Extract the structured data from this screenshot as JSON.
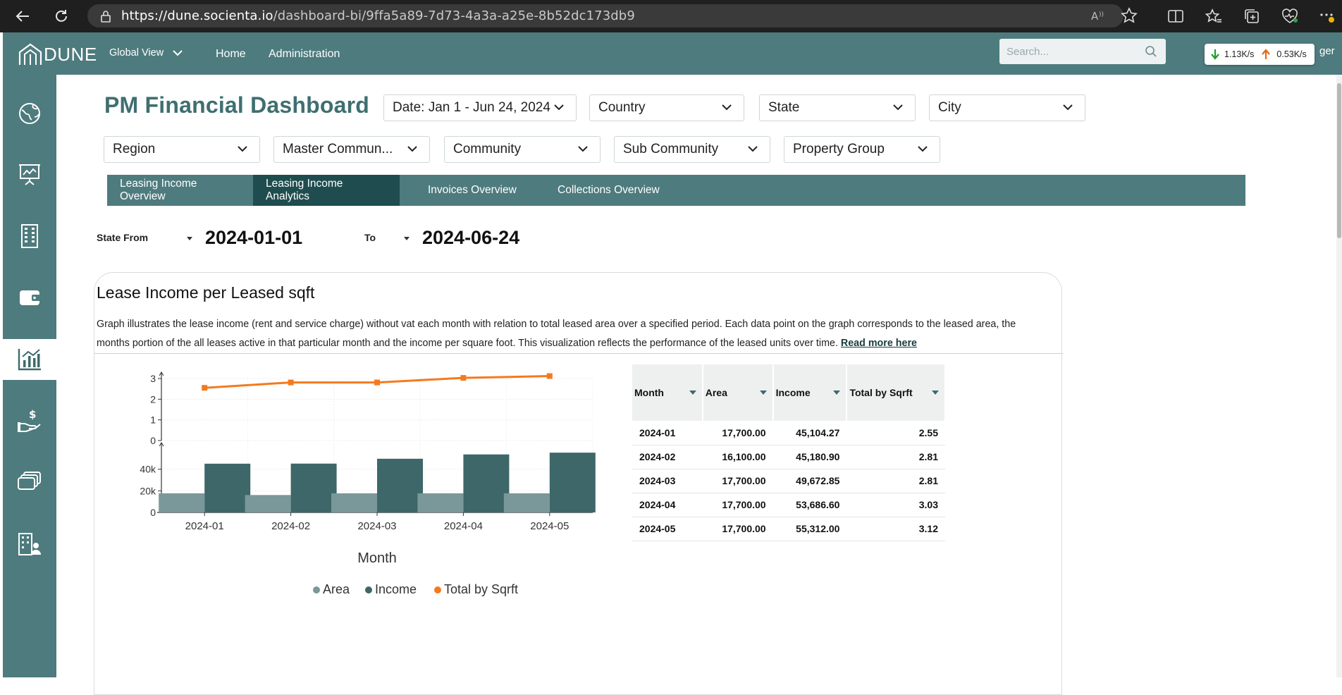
{
  "browser": {
    "url_host": "https://dune.socienta.io",
    "url_path": "/dashboard-bi/9ffa5a89-7d73-4a3a-a25e-8b52dc173db9"
  },
  "header": {
    "logo_text": "DUNE",
    "global_view": "Global View",
    "nav": [
      "Home",
      "Administration"
    ],
    "search_placeholder": "Search...",
    "download_speed": "1.13K/s",
    "upload_speed": "0.53K/s",
    "user_partial": "ger"
  },
  "sidebar": {
    "items": [
      {
        "icon": "globe-icon",
        "active": false
      },
      {
        "icon": "presentation-chart-icon",
        "active": false
      },
      {
        "icon": "building-icon",
        "active": false
      },
      {
        "icon": "wallet-icon",
        "active": false
      },
      {
        "icon": "analytics-chart-icon",
        "active": true
      },
      {
        "icon": "hand-dollar-icon",
        "active": false
      },
      {
        "icon": "stacked-cards-icon",
        "active": false
      },
      {
        "icon": "building-person-icon",
        "active": false
      }
    ]
  },
  "page": {
    "title": "PM Financial Dashboard",
    "filters_row1": [
      "Date: Jan 1 - Jun 24, 2024",
      "Country",
      "State",
      "City"
    ],
    "filters_row2": [
      "Region",
      "Master Commun...",
      "Community",
      "Sub Community",
      "Property Group"
    ],
    "tabs": [
      {
        "label": "Leasing Income Overview",
        "active": false
      },
      {
        "label": "Leasing Income Analytics",
        "active": true
      },
      {
        "label": "Invoices Overview",
        "active": false
      },
      {
        "label": "Collections Overview",
        "active": false
      }
    ],
    "state_from_label": "State From",
    "state_from_value": "2024-01-01",
    "to_label": "To",
    "to_value": "2024-06-24"
  },
  "card": {
    "title": "Lease Income per Leased sqft",
    "description": "Graph illustrates the lease income (rent and service charge) without vat each month with relation to total leased area over a specified period. Each data point on the graph corresponds to the leased area, the months portion of the all leases active in that particular month and the income per square foot. This visualization reflects the performance of the leased units over time.",
    "read_more": "Read more here"
  },
  "table": {
    "headers": [
      "Month",
      "Area",
      "Income",
      "Total by Sqrft"
    ],
    "rows": [
      [
        "2024-01",
        "17,700.00",
        "45,104.27",
        "2.55"
      ],
      [
        "2024-02",
        "16,100.00",
        "45,180.90",
        "2.81"
      ],
      [
        "2024-03",
        "17,700.00",
        "49,672.85",
        "2.81"
      ],
      [
        "2024-04",
        "17,700.00",
        "53,686.60",
        "3.03"
      ],
      [
        "2024-05",
        "17,700.00",
        "55,312.00",
        "3.12"
      ]
    ]
  },
  "colors": {
    "brand": "#4e7b7e",
    "tab_active": "#1f4d4f",
    "area_bar": "#7a9799",
    "income_bar": "#3d6769",
    "line": "#f47a1f"
  },
  "chart_data": {
    "type": "bar",
    "categories": [
      "2024-01",
      "2024-02",
      "2024-03",
      "2024-04",
      "2024-05"
    ],
    "series": [
      {
        "name": "Area",
        "type": "bar",
        "values": [
          17700,
          16100,
          17700,
          17700,
          17700
        ]
      },
      {
        "name": "Income",
        "type": "bar",
        "values": [
          45104.27,
          45180.9,
          49672.85,
          53686.6,
          55312.0
        ]
      },
      {
        "name": "Total by Sqrft",
        "type": "line",
        "values": [
          2.55,
          2.81,
          2.81,
          3.03,
          3.12
        ]
      }
    ],
    "xlabel": "Month",
    "top_panel": {
      "ylim": [
        0,
        3
      ],
      "ticks": [
        "0",
        "1",
        "2",
        "3"
      ]
    },
    "bottom_panel": {
      "ylim": [
        0,
        60000
      ],
      "ticks": [
        "0",
        "20k",
        "40k"
      ]
    },
    "legend": [
      "Area",
      "Income",
      "Total by Sqrft"
    ],
    "legend_position": "bottom",
    "grid": true
  }
}
